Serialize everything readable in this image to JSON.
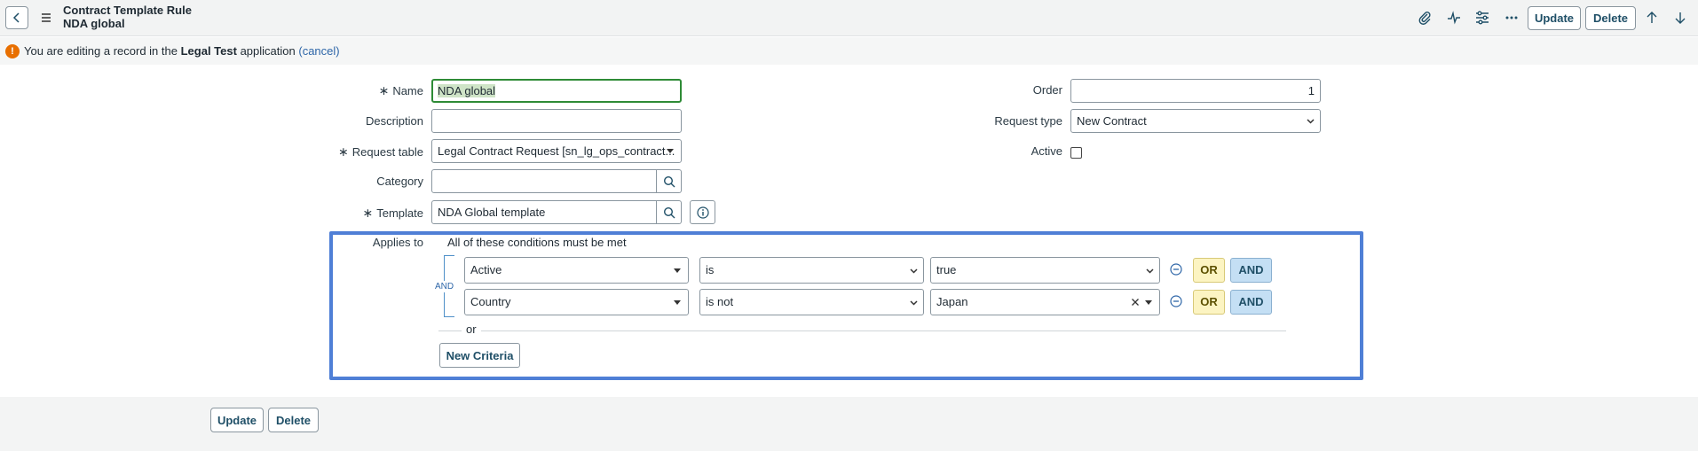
{
  "header": {
    "title": "Contract Template Rule",
    "subtitle": "NDA global",
    "update_label": "Update",
    "delete_label": "Delete"
  },
  "info_bar": {
    "prefix": "You are editing a record in the",
    "app_name": "Legal Test",
    "suffix": "application",
    "cancel_label": "(cancel)"
  },
  "form": {
    "name_label": "Name",
    "name_value": "NDA global",
    "description_label": "Description",
    "description_value": "",
    "request_table_label": "Request table",
    "request_table_value": "Legal Contract Request [sn_lg_ops_contract...",
    "category_label": "Category",
    "category_value": "",
    "template_label": "Template",
    "template_value": "NDA Global template",
    "order_label": "Order",
    "order_value": "1",
    "request_type_label": "Request type",
    "request_type_value": "New Contract",
    "active_label": "Active",
    "active_checked": false,
    "required_marker": "∗"
  },
  "conditions": {
    "applies_to_label": "Applies to",
    "summary": "All of these conditions must be met",
    "and_connector": "AND",
    "or_separator": "or",
    "rows": [
      {
        "field": "Active",
        "operator": "is",
        "value": "true"
      },
      {
        "field": "Country",
        "operator": "is not",
        "value": "Japan"
      }
    ],
    "or_label": "OR",
    "and_label": "AND",
    "new_criteria_label": "New Criteria"
  },
  "footer": {
    "update_label": "Update",
    "delete_label": "Delete"
  },
  "colors": {
    "accent": "#4f7fd6",
    "focus": "#2e8b36",
    "warning": "#e86f00"
  }
}
